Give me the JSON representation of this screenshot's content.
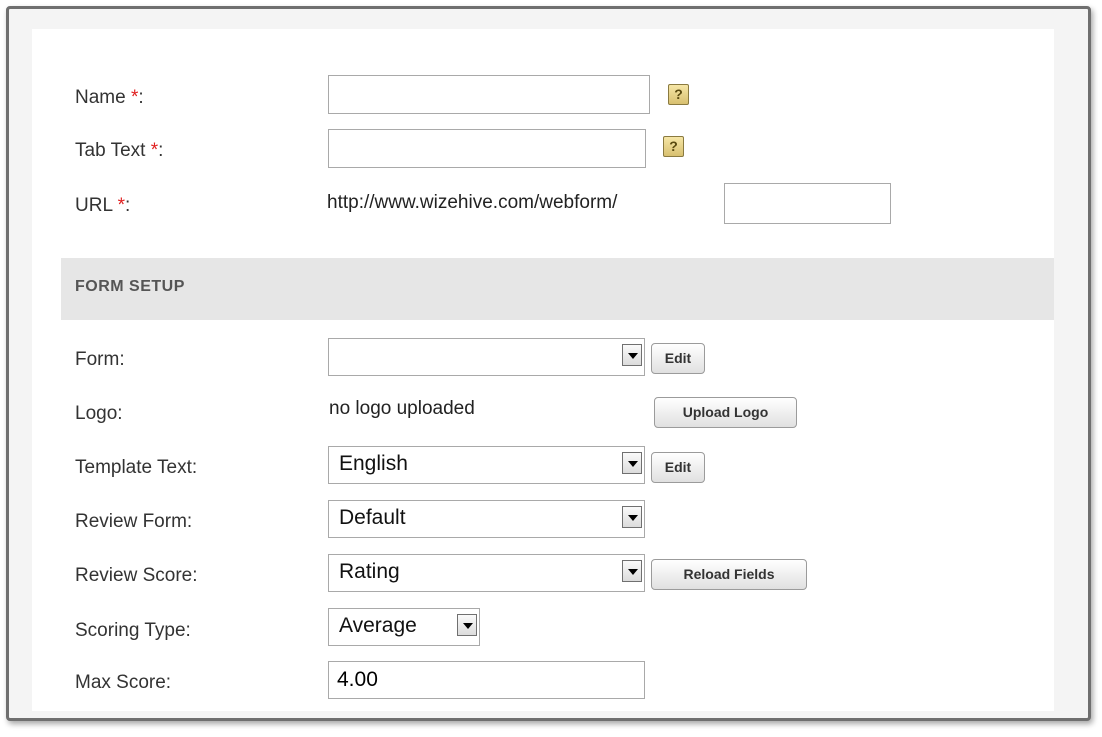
{
  "fields": {
    "name": {
      "label": "Name ",
      "required_mark": "*",
      "colon": ":",
      "value": ""
    },
    "tab_text": {
      "label": "Tab Text ",
      "required_mark": "*",
      "colon": ":",
      "value": ""
    },
    "url": {
      "label": "URL ",
      "required_mark": "*",
      "colon": ":",
      "prefix": "http://www.wizehive.com/webform/",
      "value": ""
    }
  },
  "help_icon_text": "?",
  "section": {
    "title": "FORM SETUP"
  },
  "form_setup": {
    "form": {
      "label": "Form:",
      "selected": "",
      "edit_label": "Edit"
    },
    "logo": {
      "label": "Logo:",
      "status": "no logo uploaded",
      "upload_label": "Upload Logo"
    },
    "template_text": {
      "label": "Template Text:",
      "selected": "English",
      "edit_label": "Edit"
    },
    "review_form": {
      "label": "Review Form:",
      "selected": "Default"
    },
    "review_score": {
      "label": "Review Score:",
      "selected": "Rating",
      "reload_label": "Reload Fields"
    },
    "scoring_type": {
      "label": "Scoring Type:",
      "selected": "Average"
    },
    "max_score": {
      "label": "Max Score:",
      "value": "4.00"
    }
  },
  "icons": {
    "help": "question-mark-help-icon",
    "dropdown": "chevron-down-icon"
  }
}
